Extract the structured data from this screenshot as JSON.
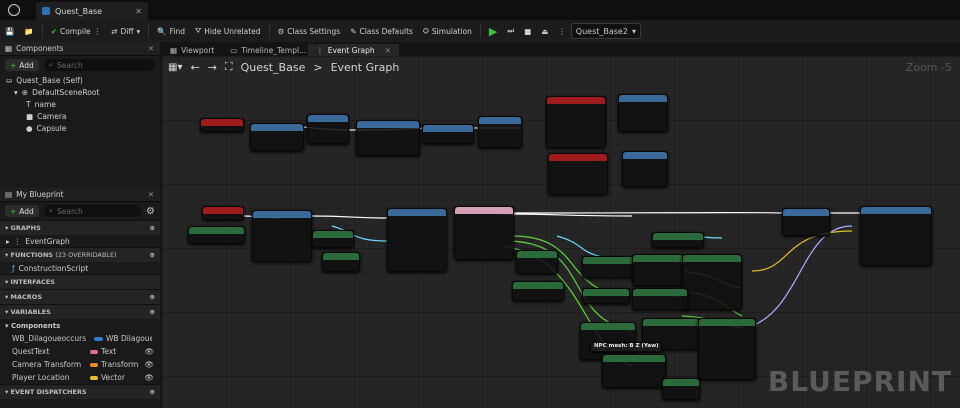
{
  "window": {
    "tab_title": "Quest_Base"
  },
  "toolbar": {
    "compile": "Compile",
    "diff": "Diff",
    "find": "Find",
    "hide_unrelated": "Hide Unrelated",
    "class_settings": "Class Settings",
    "class_defaults": "Class Defaults",
    "simulation": "Simulation",
    "debug_object": "Quest_Base2"
  },
  "components": {
    "title": "Components",
    "add": "Add",
    "search_placeholder": "Search",
    "root": "Quest_Base (Self)",
    "scene_root": "DefaultSceneRoot",
    "items": [
      "name",
      "Camera",
      "Capsule"
    ]
  },
  "my_blueprint": {
    "title": "My Blueprint",
    "add": "Add",
    "search_placeholder": "Search",
    "graphs": "GRAPHS",
    "event_graph": "EventGraph",
    "functions": "FUNCTIONS",
    "functions_count": "(23 OVERRIDABLE)",
    "construction_script": "ConstructionScript",
    "interfaces": "INTERFACES",
    "macros": "MACROS",
    "variables": "VARIABLES",
    "components_group": "Components",
    "vars": [
      {
        "name": "WB_Dilagoueoccurs",
        "type": "WB Dilagoue",
        "color": "#2f7bd6"
      },
      {
        "name": "QuestText",
        "type": "Text",
        "color": "#e06aa6"
      },
      {
        "name": "Camera Transform",
        "type": "Transform",
        "color": "#e88b2a"
      },
      {
        "name": "Player Location",
        "type": "Vector",
        "color": "#e3c02b"
      }
    ],
    "event_dispatchers": "EVENT DISPATCHERS"
  },
  "doc_tabs": [
    "Viewport",
    "Timeline_Templ...",
    "Event Graph"
  ],
  "breadcrumb": {
    "root": "Quest_Base",
    "sep": ">",
    "current": "Event Graph"
  },
  "graph": {
    "zoom": "Zoom -5",
    "watermark": "BLUEPRINT",
    "comment": "NPC mesh: B Z (Yaw)"
  },
  "colors": {
    "accent": "#2f7bd6",
    "play": "#3fbf3f",
    "event": "#a01b1b",
    "function": "#3a6a9a",
    "exec_wire": "#ffffff",
    "green_wire": "#62d23e"
  }
}
